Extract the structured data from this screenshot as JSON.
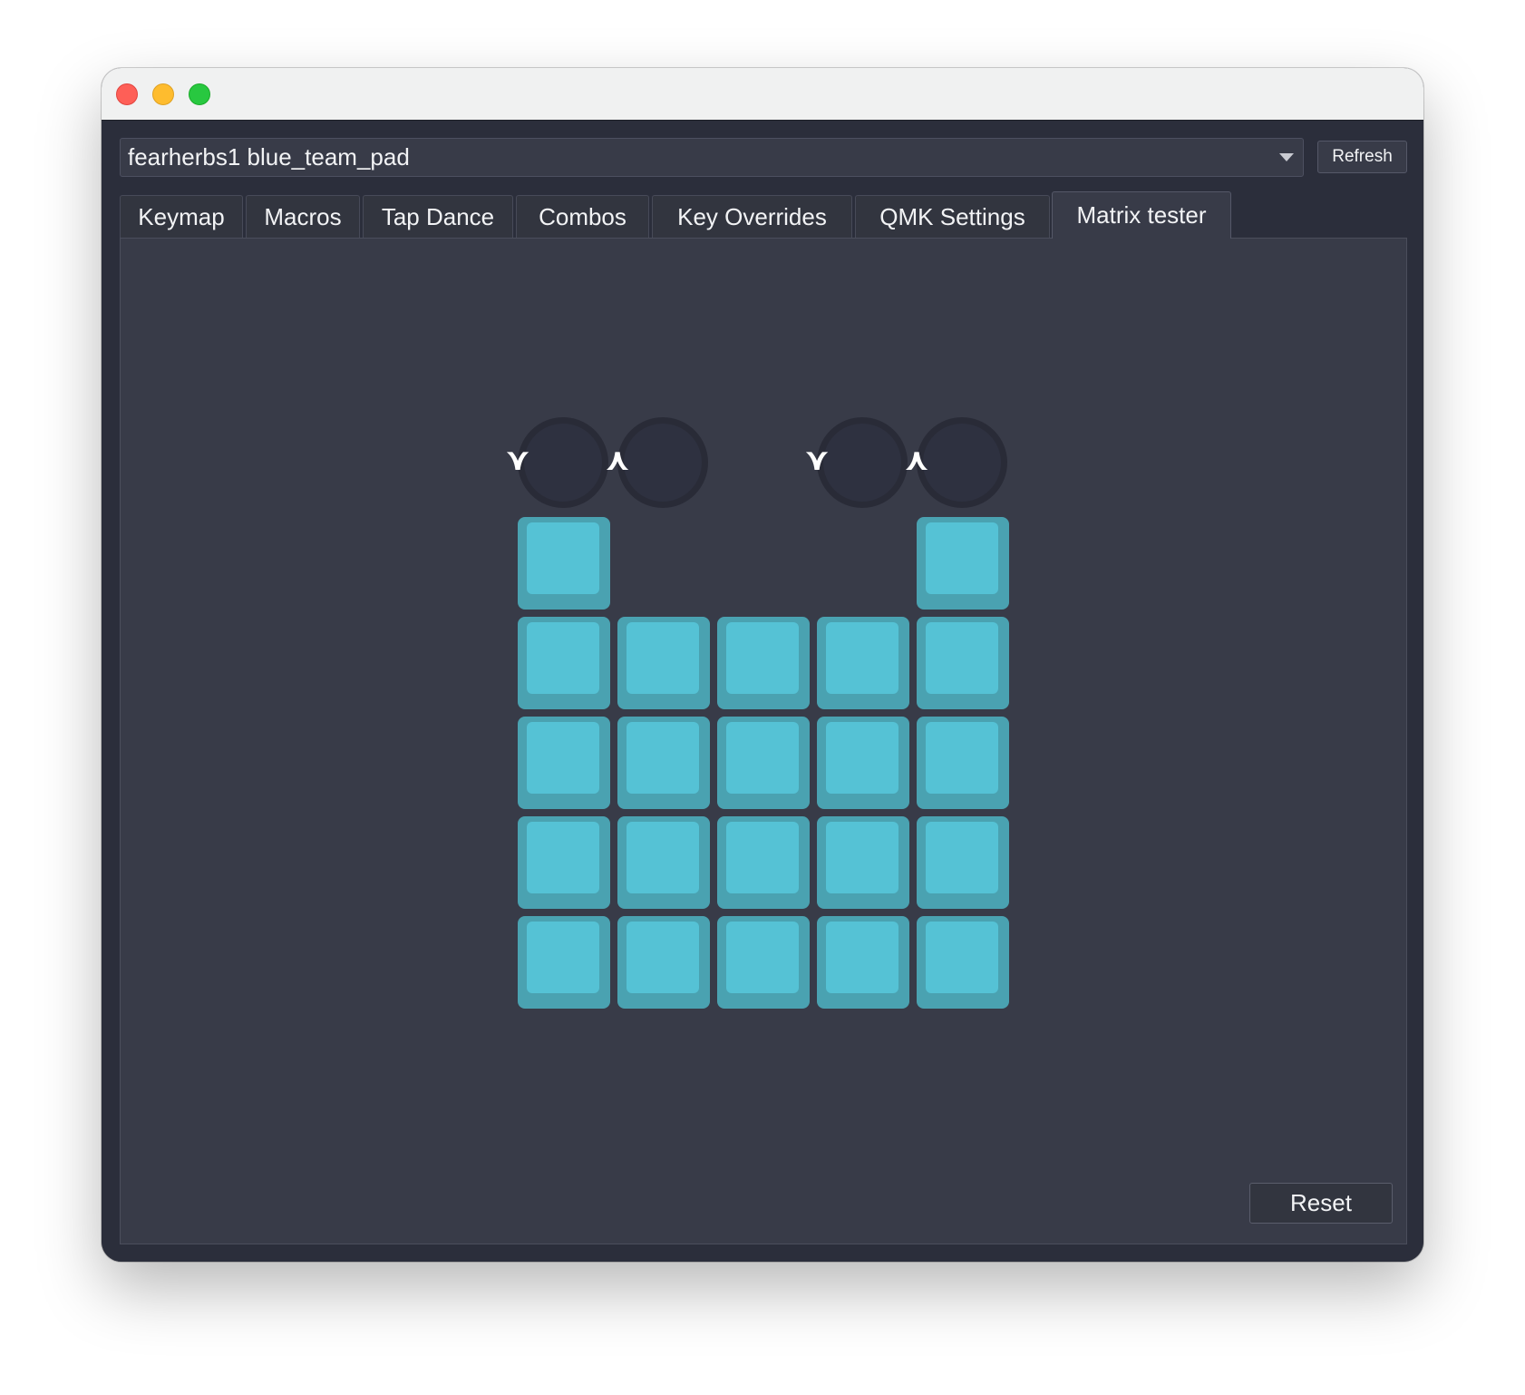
{
  "window": {
    "controls": [
      "close",
      "minimize",
      "zoom"
    ]
  },
  "toolbar": {
    "device_name": "fearherbs1 blue_team_pad",
    "refresh_label": "Refresh"
  },
  "tabs": [
    {
      "label": "Keymap",
      "active": false
    },
    {
      "label": "Macros",
      "active": false
    },
    {
      "label": "Tap Dance",
      "active": false
    },
    {
      "label": "Combos",
      "active": false
    },
    {
      "label": "Key Overrides",
      "active": false
    },
    {
      "label": "QMK Settings",
      "active": false
    },
    {
      "label": "Matrix tester",
      "active": true
    }
  ],
  "matrix": {
    "encoders": [
      {
        "ccw_symbol": "⋎",
        "cw_symbol": "⋏"
      },
      {
        "ccw_symbol": "⋎",
        "cw_symbol": "⋏"
      }
    ],
    "rows": [
      [
        1,
        0,
        0,
        0,
        1
      ],
      [
        1,
        1,
        1,
        1,
        1
      ],
      [
        1,
        1,
        1,
        1,
        1
      ],
      [
        1,
        1,
        1,
        1,
        1
      ],
      [
        1,
        1,
        1,
        1,
        1
      ]
    ],
    "key_color": "#55c2d5",
    "key_edge_color": "#4aa2b1",
    "encoder_color": "#2e3140"
  },
  "footer": {
    "reset_label": "Reset"
  },
  "colors": {
    "background": "#2b2e3b",
    "panel": "#383b48",
    "text": "#f2f3f5"
  }
}
